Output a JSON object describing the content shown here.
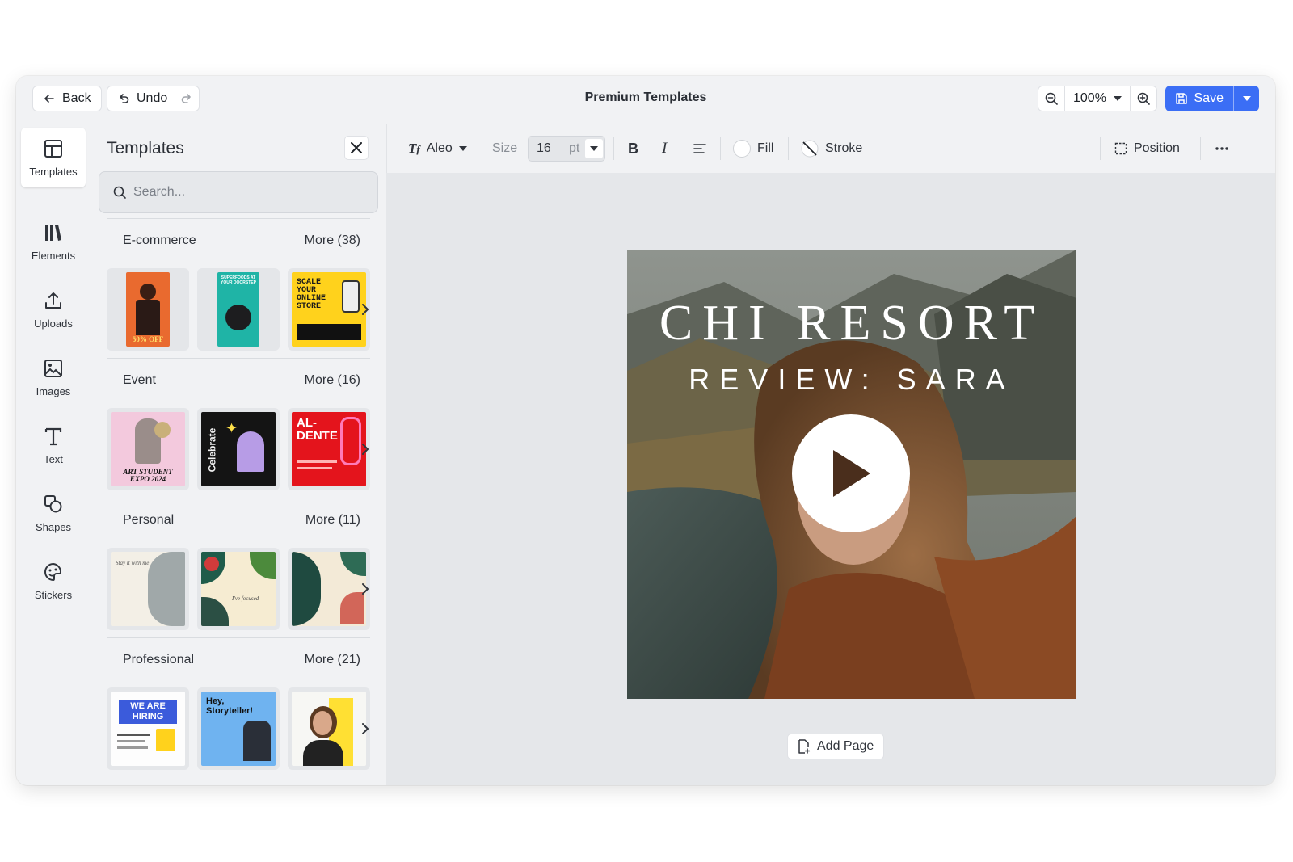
{
  "app": {
    "title": "Premium Templates",
    "back_label": "Back",
    "undo_label": "Undo",
    "zoom": "100%",
    "save_label": "Save",
    "accent": "#3b6ef5"
  },
  "rail": {
    "items": [
      {
        "label": "Templates",
        "icon": "templates-icon"
      },
      {
        "label": "Elements",
        "icon": "elements-icon"
      },
      {
        "label": "Uploads",
        "icon": "upload-icon"
      },
      {
        "label": "Images",
        "icon": "image-icon"
      },
      {
        "label": "Text",
        "icon": "text-icon"
      },
      {
        "label": "Shapes",
        "icon": "shapes-icon"
      },
      {
        "label": "Stickers",
        "icon": "sticker-icon"
      }
    ]
  },
  "panel": {
    "title": "Templates",
    "search_placeholder": "Search...",
    "sections": [
      {
        "name": "E-commerce",
        "more": "More (38)",
        "thumbs": [
          {
            "text": "50% OFF"
          },
          {
            "text": "SUPERFOODS AT YOUR DOORSTEP"
          },
          {
            "text": "SCALE YOUR ONLINE STORE"
          }
        ]
      },
      {
        "name": "Event",
        "more": "More (16)",
        "thumbs": [
          {
            "text": "ART STUDENT EXPO 2024"
          },
          {
            "text": "Celebrate"
          },
          {
            "text": "AL-DENTE"
          }
        ]
      },
      {
        "name": "Personal",
        "more": "More (11)",
        "thumbs": [
          {
            "text": "Stay it with me"
          },
          {
            "text": "I've focused"
          },
          {
            "text": ""
          }
        ]
      },
      {
        "name": "Professional",
        "more": "More (21)",
        "thumbs": [
          {
            "text": "WE ARE HIRING"
          },
          {
            "text": "Hey, Storyteller!"
          },
          {
            "text": ""
          }
        ]
      }
    ]
  },
  "toolbar": {
    "font": "Aleo",
    "size_label": "Size",
    "size_value": "16",
    "size_unit": "pt",
    "fill_label": "Fill",
    "stroke_label": "Stroke",
    "position_label": "Position"
  },
  "canvas": {
    "headline": "CHI RESORT",
    "subheadline": "REVIEW: SARA",
    "add_page_label": "Add Page"
  }
}
